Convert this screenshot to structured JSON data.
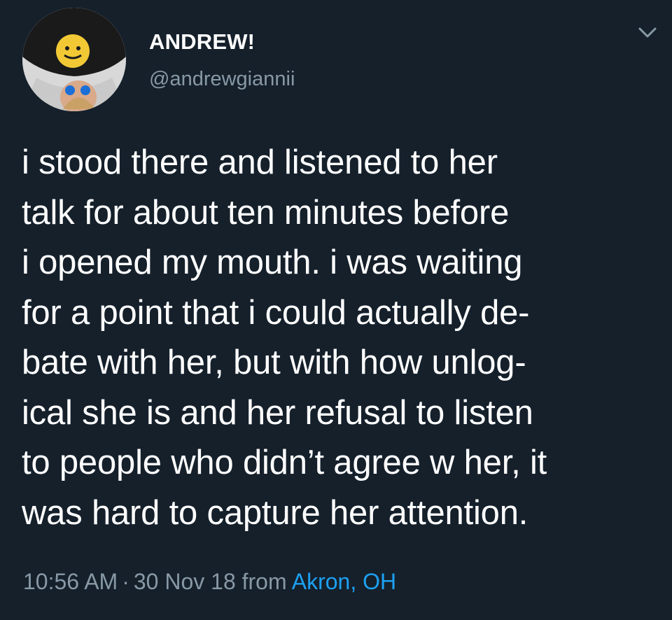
{
  "author": {
    "display_name": "ANDREW!",
    "handle": "@andrewgiannii",
    "avatar_icon": "profile-photo"
  },
  "menu": {
    "icon": "chevron-down-icon"
  },
  "tweet": {
    "text": "i stood there and listened to her\ntalk for about ten minutes before\ni opened my mouth. i was waiting\nfor a point that i could actually de-\nbate with her, but with how unlog-\nical she is and her refusal to listen\nto people who didn’t agree w her, it\nwas hard to capture her attention."
  },
  "meta": {
    "time": "10:56 AM",
    "separator": "·",
    "date": "30 Nov 18",
    "from_label": "from",
    "location": "Akron, OH"
  },
  "colors": {
    "background": "#15202b",
    "text": "#ffffff",
    "secondary_text": "#8899a6",
    "link": "#1da1f2"
  }
}
